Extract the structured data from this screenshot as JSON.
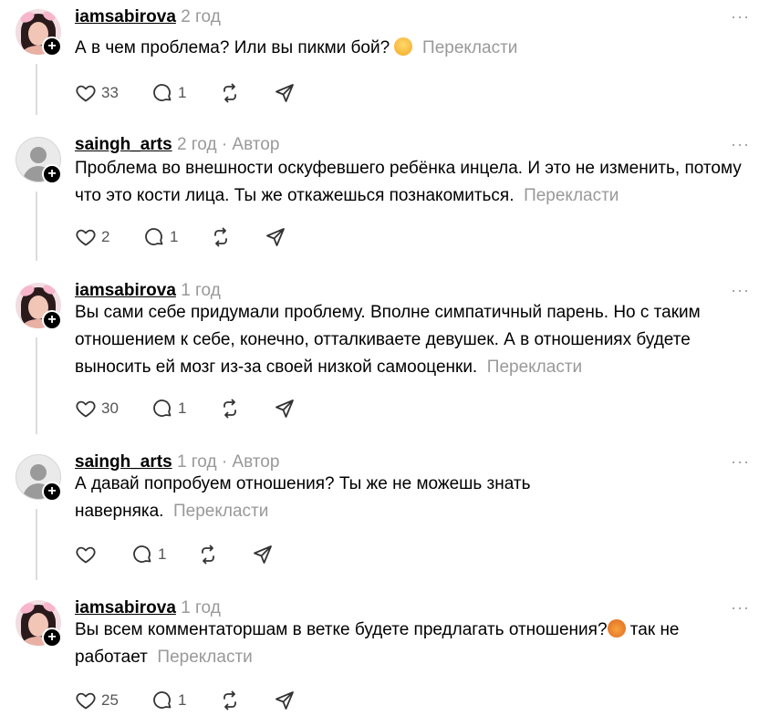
{
  "translate_label": "Перекласти",
  "posts": [
    {
      "username": "iamsabirova",
      "time": "2 год",
      "author_tag": "",
      "avatar": "photo",
      "text": "А в чем проблема? Или вы пикми бой?",
      "emoji": "hugging-face-emoji",
      "likes": "33",
      "replies": "1"
    },
    {
      "username": "saingh_arts",
      "time": "2 год",
      "author_tag": "· Автор",
      "avatar": "default",
      "text": "Проблема во внешности оскуфевшего ребёнка инцела. И это не изменить, потому что это кости лица. Ты же откажешься познакомиться.",
      "likes": "2",
      "replies": "1"
    },
    {
      "username": "iamsabirova",
      "time": "1 год",
      "author_tag": "",
      "avatar": "photo",
      "text": "Вы сами себе придумали проблему. Вполне симпатичный парень. Но с таким отношением к себе, конечно, отталкиваете девушек. А в отношениях будете выносить ей мозг из-за своей низкой самооценки.",
      "likes": "30",
      "replies": "1"
    },
    {
      "username": "saingh_arts",
      "time": "1 год",
      "author_tag": "· Автор",
      "avatar": "default",
      "text": "А давай попробуем отношения? Ты же не можешь знать наверняка.",
      "likes": "",
      "replies": "1"
    },
    {
      "username": "iamsabirova",
      "time": "1 год",
      "author_tag": "",
      "avatar": "photo",
      "text": "Вы всем комментаторшам в ветке будете предлагать отношения?",
      "emoji": "crying-cat-emoji",
      "text_after": "так не работает",
      "likes": "25",
      "replies": "1"
    }
  ],
  "more_label": "···"
}
